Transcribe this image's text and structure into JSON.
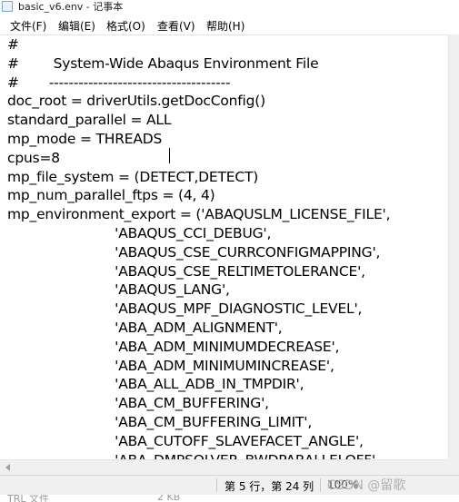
{
  "window": {
    "title": "basic_v6.env - 记事本"
  },
  "menu": {
    "items": [
      "文件(F)",
      "编辑(E)",
      "格式(O)",
      "查看(V)",
      "帮助(H)"
    ]
  },
  "editor": {
    "lines": [
      "#",
      "#        System-Wide Abaqus Environment File",
      "#       -------------------------------------",
      "doc_root = driverUtils.getDocConfig()",
      "standard_parallel = ALL",
      "mp_mode = THREADS",
      "cpus=8",
      "mp_file_system = (DETECT,DETECT)",
      "mp_num_parallel_ftps = (4, 4)",
      "mp_environment_export = ('ABAQUSLM_LICENSE_FILE',",
      "                         'ABAQUS_CCI_DEBUG',",
      "                         'ABAQUS_CSE_CURRCONFIGMAPPING',",
      "                         'ABAQUS_CSE_RELTIMETOLERANCE',",
      "                         'ABAQUS_LANG',",
      "                         'ABAQUS_MPF_DIAGNOSTIC_LEVEL',",
      "                         'ABA_ADM_ALIGNMENT',",
      "                         'ABA_ADM_MINIMUMDECREASE',",
      "                         'ABA_ADM_MINIMUMINCREASE',",
      "                         'ABA_ALL_ADB_IN_TMPDIR',",
      "                         'ABA_CM_BUFFERING',",
      "                         'ABA_CM_BUFFERING_LIMIT',",
      "                         'ABA_CUTOFF_SLAVEFACET_ANGLE',",
      "                         'ABA_DMPSOLVER_BWDPARALLELOFF',"
    ]
  },
  "status": {
    "position": "第 5 行，第 24 列",
    "extra": "100%"
  },
  "watermark": "CSDN @留歌",
  "below": {
    "left": "TRL 文件",
    "right": "2 KB"
  }
}
